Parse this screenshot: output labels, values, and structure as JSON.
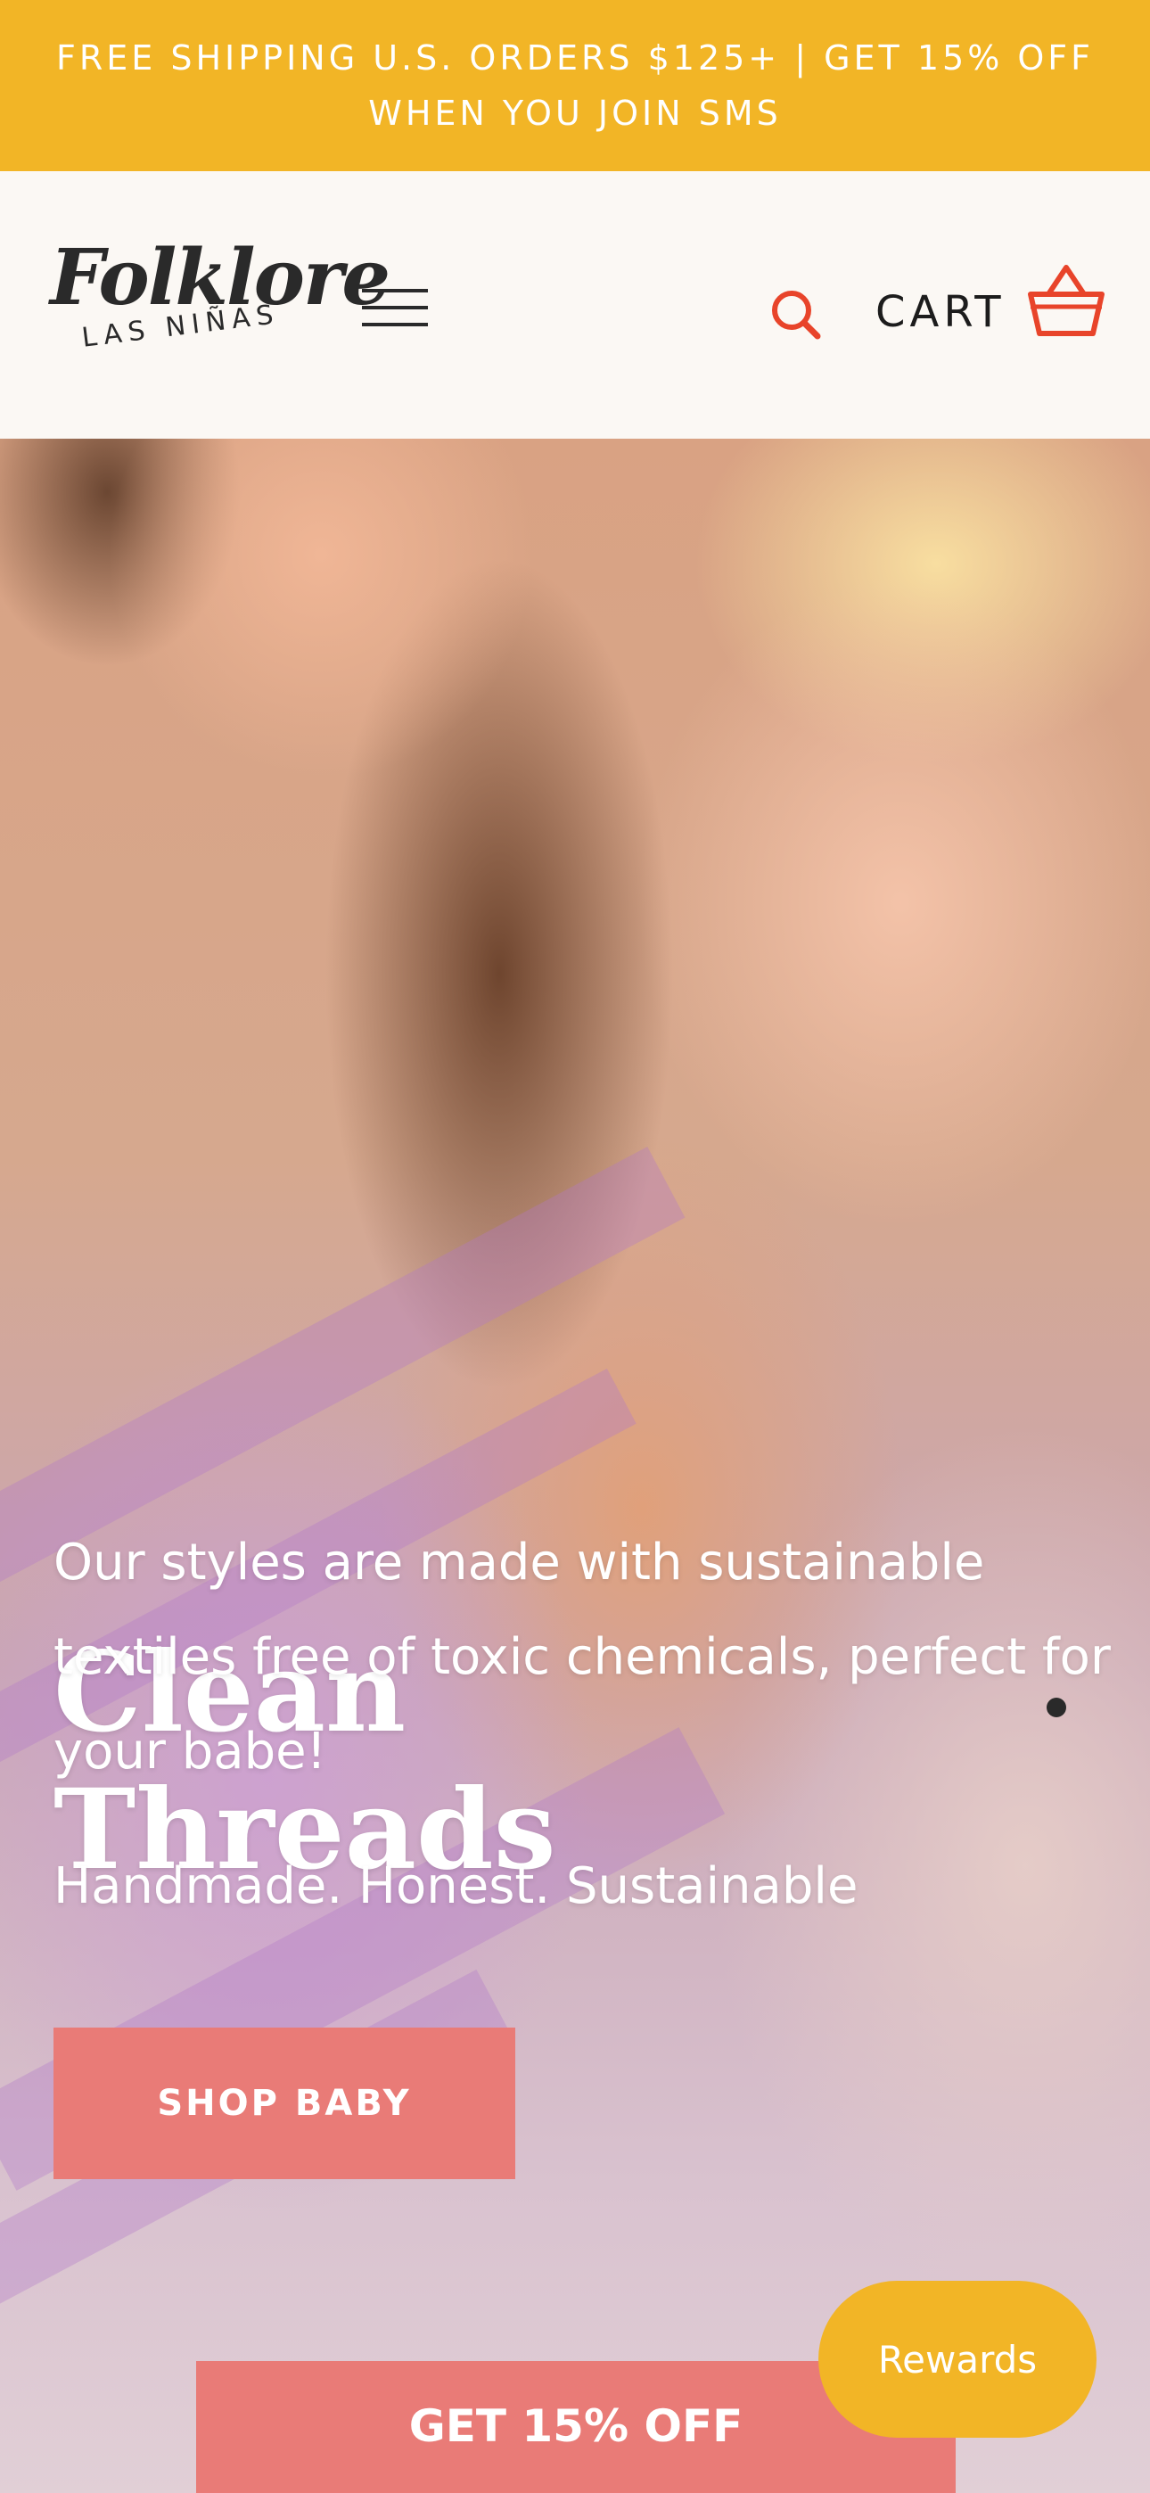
{
  "announcement": {
    "line1": "FREE SHIPPING U.S. ORDERS $125+ | GET 15% OFF",
    "line2": "WHEN YOU JOIN SMS"
  },
  "header": {
    "logo_main": "Folklore",
    "logo_sub": "LAS NIÑAS",
    "menu_icon": "hamburger-menu-icon",
    "search_icon": "search-icon",
    "cart_label": "CART",
    "cart_icon": "shopping-basket-icon"
  },
  "hero": {
    "title_line1": "Clean",
    "title_line2": "Threads",
    "body": "Our styles are made with sustainable textiles free of toxic chemicals, perfect for your babe!",
    "tagline": "Handmade. Honest. Sustainable",
    "cta_label": "SHOP BABY"
  },
  "floating": {
    "offer_label": "GET 15% OFF",
    "rewards_label": "Rewards"
  },
  "colors": {
    "announcement_bg": "#f2b526",
    "accent_coral": "#e97b77",
    "icon_red": "#e8442a",
    "header_bg": "#fbf8f4"
  }
}
